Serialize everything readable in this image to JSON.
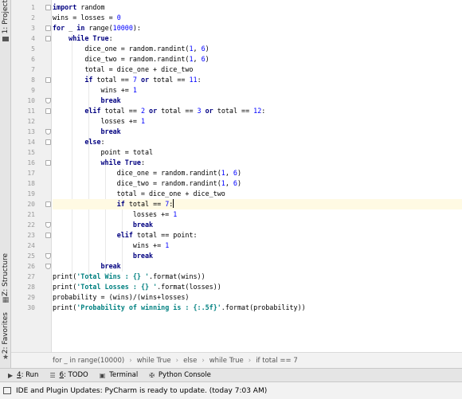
{
  "left_strip": {
    "project_tab": "1: Project",
    "structure_tab": "Z: Structure",
    "favorites_tab": "2: Favorites"
  },
  "editor": {
    "line_numbers": [
      "1",
      "2",
      "3",
      "4",
      "5",
      "6",
      "7",
      "8",
      "9",
      "10",
      "11",
      "12",
      "13",
      "14",
      "15",
      "16",
      "17",
      "18",
      "19",
      "20",
      "21",
      "22",
      "23",
      "24",
      "25",
      "26",
      "27",
      "28",
      "29",
      "30"
    ],
    "current_line": 20
  },
  "breadcrumb": {
    "items": [
      "for _ in range(10000)",
      "while True",
      "else",
      "while True",
      "if total == 7"
    ]
  },
  "tool_tabs": {
    "run": {
      "key": "4",
      "label": ": Run"
    },
    "todo": {
      "key": "6",
      "label": ": TODO"
    },
    "terminal": {
      "label": "Terminal"
    },
    "python_console": {
      "label": "Python Console"
    }
  },
  "status": {
    "message": "IDE and Plugin Updates: PyCharm is ready to update. (today 7:03 AM)"
  }
}
